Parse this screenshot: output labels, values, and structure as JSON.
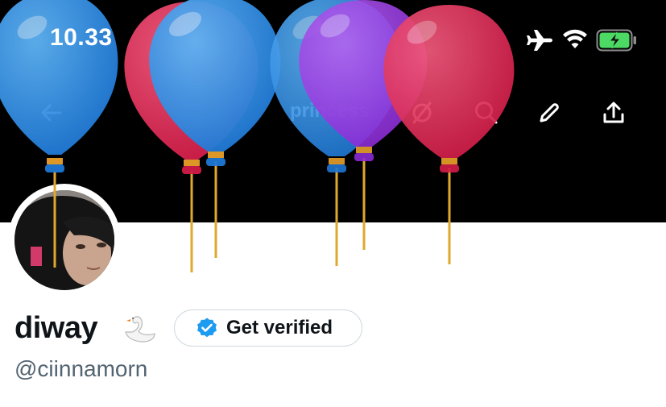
{
  "status_bar": {
    "time": "10.33",
    "icons": [
      "airplane-icon",
      "wifi-icon",
      "battery-charging-icon"
    ],
    "battery_color": "#4cd964"
  },
  "nav": {
    "back_icon": "arrow-left-icon",
    "title": "princess",
    "actions": [
      "circle-slash-icon",
      "search-icon",
      "pencil-icon",
      "share-upload-icon"
    ]
  },
  "profile": {
    "display_name": "diway",
    "name_emoji": "🦢",
    "verify_label": "Get verified",
    "handle": "@ciinnamorn"
  },
  "colors": {
    "verified_blue": "#1d9bf0",
    "text_primary": "#0f1419",
    "text_secondary": "#536471",
    "balloon_blue": "#2d8fe0",
    "balloon_red": "#e23a5e",
    "balloon_purple": "#9b3ce6"
  }
}
